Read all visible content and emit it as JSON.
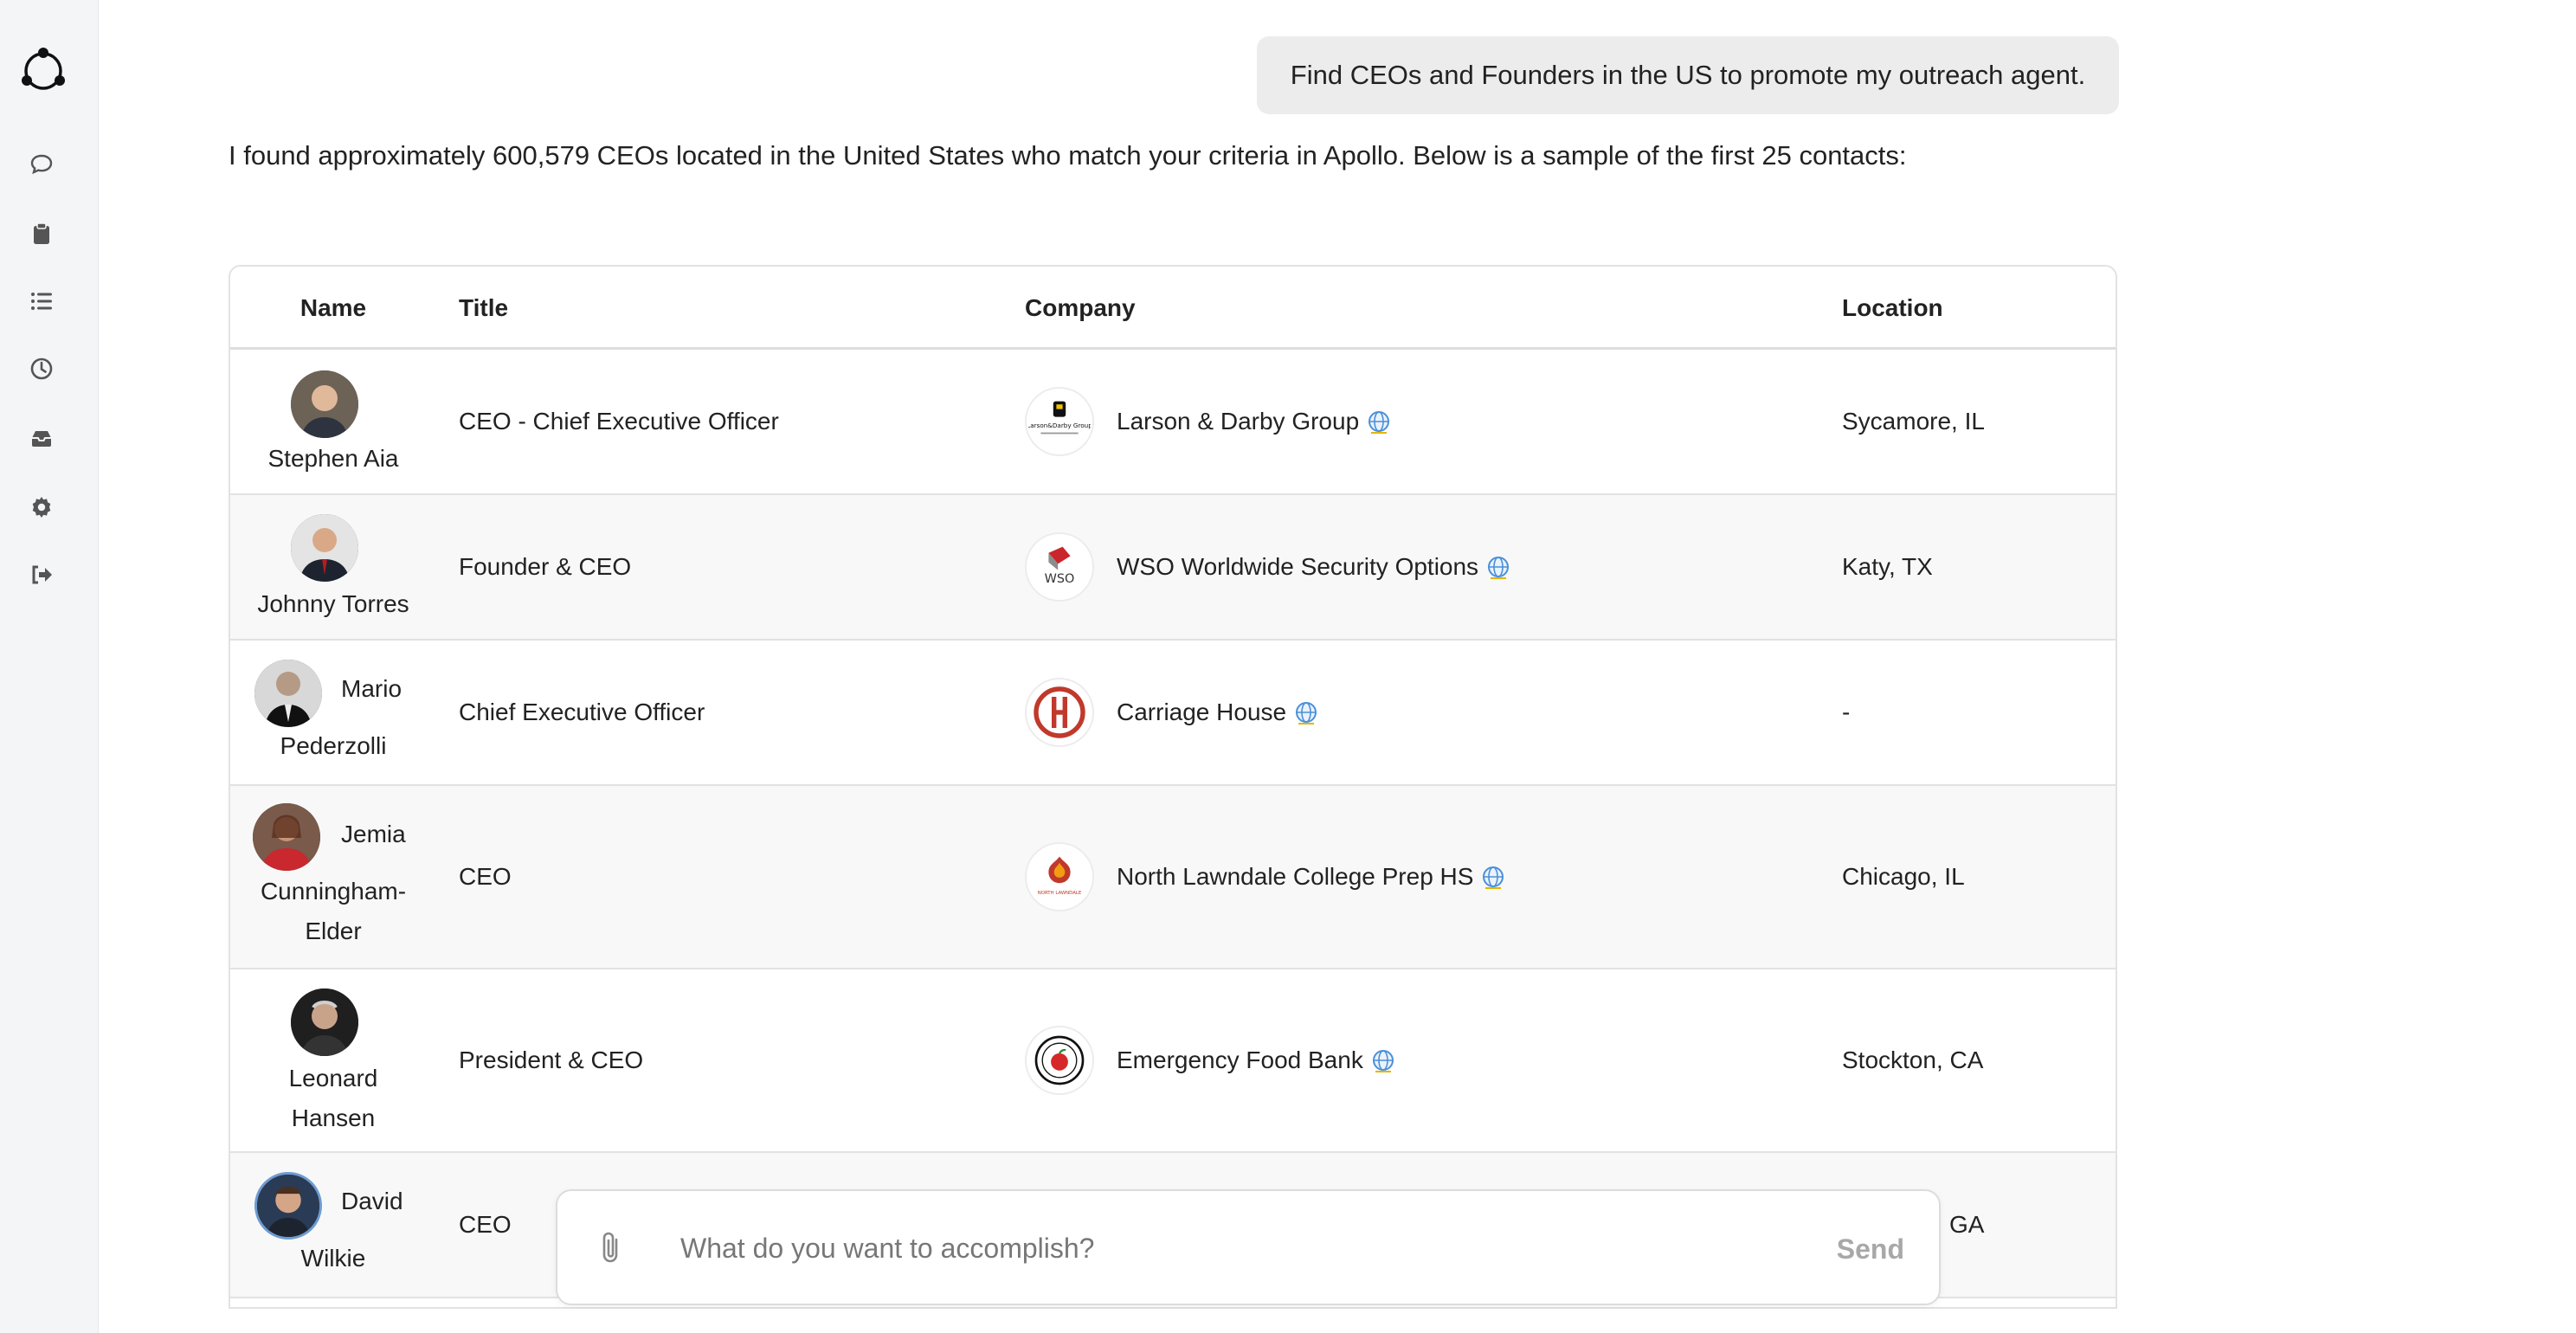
{
  "sidebar": {
    "icons": [
      {
        "name": "chat-icon"
      },
      {
        "name": "clipboard-icon"
      },
      {
        "name": "list-icon"
      },
      {
        "name": "clock-icon"
      },
      {
        "name": "inbox-icon"
      },
      {
        "name": "gear-icon"
      },
      {
        "name": "sign-out-icon"
      }
    ]
  },
  "conversation": {
    "user_message": "Find CEOs and Founders in the US to promote my outreach agent.",
    "assistant_message": "I found approximately 600,579 CEOs located in the United States who match your criteria in Apollo. Below is a sample of the first 25 contacts:"
  },
  "table": {
    "headers": {
      "name": "Name",
      "title": "Title",
      "company": "Company",
      "location": "Location"
    },
    "rows": [
      {
        "name": "Stephen Aia",
        "name_line1": "Stephen Aia",
        "name_line2": "",
        "title": "CEO - Chief Executive Officer",
        "company": "Larson & Darby Group",
        "location": "Sycamore, IL"
      },
      {
        "name": "Johnny Torres",
        "name_line1": "Johnny Torres",
        "name_line2": "",
        "title": "Founder & CEO",
        "company": "WSO Worldwide Security Options",
        "location": "Katy, TX"
      },
      {
        "name": "Mario Pederzolli",
        "name_line1": "Mario",
        "name_line2": "Pederzolli",
        "title": "Chief Executive Officer",
        "company": "Carriage House",
        "location": "-"
      },
      {
        "name": "Jemia Cunningham-Elder",
        "name_line1": "Jemia",
        "name_line2": "Cunningham-",
        "name_line3": "Elder",
        "title": "CEO",
        "company": "North Lawndale College Prep HS",
        "location": "Chicago, IL"
      },
      {
        "name": "Leonard Hansen",
        "name_line1": "Leonard",
        "name_line2": "Hansen",
        "title": "President & CEO",
        "company": "Emergency Food Bank",
        "location": "Stockton, CA"
      },
      {
        "name": "David Wilkie",
        "name_line1": "David",
        "name_line2": "Wilkie",
        "title": "CEO",
        "company": "",
        "location": "GA"
      }
    ]
  },
  "composer": {
    "placeholder": "What do you want to accomplish?",
    "send_label": "Send"
  },
  "colors": {
    "sidebar_bg": "#f4f5f7",
    "bubble_bg": "#ececec",
    "alt_row_bg": "#f8f8f8",
    "send_disabled": "#a8a8a8",
    "globe_blue": "#4a90d9",
    "link_underline": "#e6b400"
  }
}
